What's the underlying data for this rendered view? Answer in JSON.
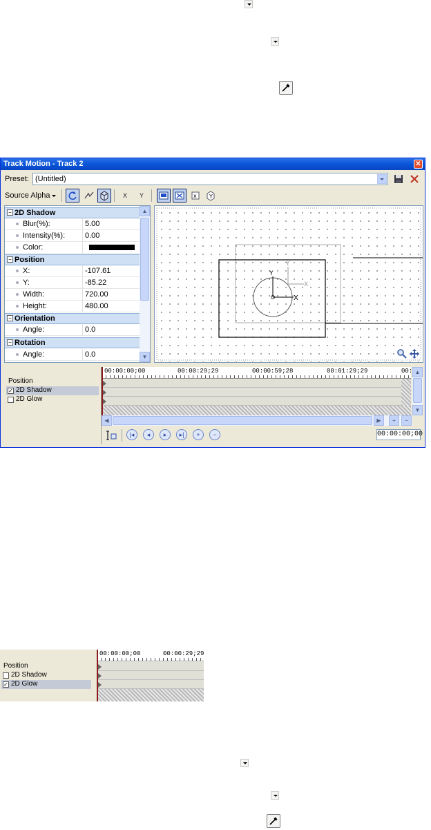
{
  "dialog": {
    "title": "Track Motion - Track 2",
    "close_glyph": "✕",
    "preset_label": "Preset:",
    "preset_value": "(Untitled)",
    "source_alpha_label": "Source Alpha",
    "toolbar_glyphs": {
      "lock_x": "X",
      "lock_y": "Y"
    }
  },
  "properties": {
    "sections": [
      {
        "title": "2D Shadow",
        "rows": [
          {
            "label": "Blur(%):",
            "value": "5.00"
          },
          {
            "label": "Intensity(%):",
            "value": "0.00"
          },
          {
            "label": "Color:",
            "value": ""
          }
        ]
      },
      {
        "title": "Position",
        "rows": [
          {
            "label": "X:",
            "value": "-107.61"
          },
          {
            "label": "Y:",
            "value": "-85.22"
          },
          {
            "label": "Width:",
            "value": "720.00"
          },
          {
            "label": "Height:",
            "value": "480.00"
          }
        ]
      },
      {
        "title": "Orientation",
        "rows": [
          {
            "label": "Angle:",
            "value": "0.0"
          }
        ]
      },
      {
        "title": "Rotation",
        "rows": [
          {
            "label": "Angle:",
            "value": "0.0"
          }
        ]
      }
    ],
    "shadow_color": "#000000",
    "collapse_glyph": "−"
  },
  "canvas": {
    "axis_x": "X",
    "axis_y": "Y"
  },
  "keyframes": {
    "tracks": [
      "Position",
      "2D Shadow",
      "2D Glow"
    ],
    "checked": [
      false,
      true,
      false
    ],
    "ruler_labels": [
      "00:00:00;00",
      "00:00:29;29",
      "00:00:59;28",
      "00:01:29;29",
      "00:"
    ],
    "timecode": "00:00:00;00",
    "check_glyph": "✓",
    "zoom_in": "+",
    "zoom_out": "−"
  },
  "snippet": {
    "tracks": [
      "Position",
      "2D Shadow",
      "2D Glow"
    ],
    "checked": [
      false,
      false,
      true
    ],
    "ruler_labels": [
      "00:00:00;00",
      "00:00:29;29"
    ]
  }
}
